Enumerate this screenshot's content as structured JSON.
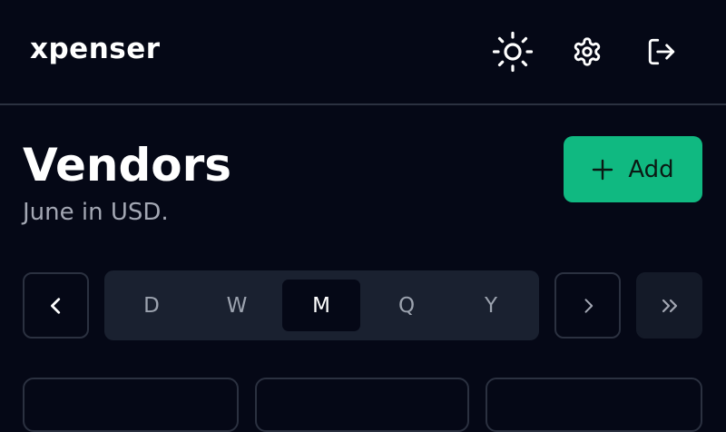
{
  "app": {
    "brand": "xpenser"
  },
  "header": {
    "icons": [
      "sun-icon",
      "gear-icon",
      "logout-icon"
    ]
  },
  "page": {
    "title": "Vendors",
    "subtitle": "June in USD."
  },
  "add_button": {
    "label": "Add",
    "icon": "plus-icon"
  },
  "period": {
    "options": [
      "D",
      "W",
      "M",
      "Q",
      "Y"
    ],
    "selected": "M"
  },
  "colors": {
    "background": "#050816",
    "accent": "#10b981",
    "border": "#2b3140",
    "muted_text": "#a3a7b3"
  }
}
